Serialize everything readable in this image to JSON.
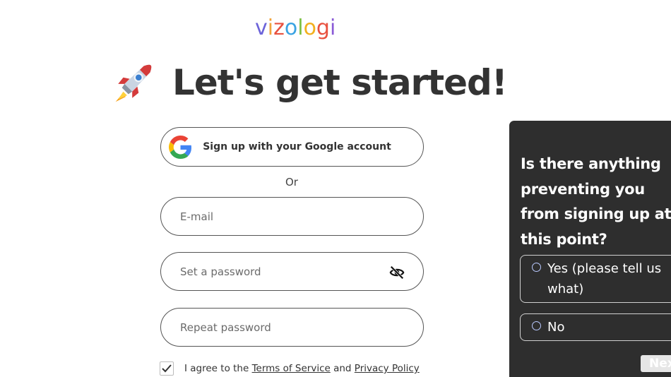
{
  "logo": {
    "letters": [
      "v",
      "i",
      "z",
      "o",
      "l",
      "o",
      "g",
      "i"
    ],
    "colors": [
      "#6c63d9",
      "#f2a33a",
      "#e8513f",
      "#3aa3e3",
      "#7bc043",
      "#f2b01e",
      "#e8513f",
      "#8a5bd6"
    ]
  },
  "heading": {
    "text": "Let's get started!",
    "icon": "rocket-icon"
  },
  "google_button": {
    "label": "Sign up with your Google account",
    "icon": "google-icon"
  },
  "divider_text": "Or",
  "fields": {
    "email": {
      "placeholder": "E-mail",
      "value": ""
    },
    "password": {
      "placeholder": "Set a password",
      "value": "",
      "icon": "eye-off-icon"
    },
    "repeat_password": {
      "placeholder": "Repeat password",
      "value": ""
    }
  },
  "agreement": {
    "checked": true,
    "prefix": "I agree to the ",
    "terms_link": "Terms of Service",
    "and": " and ",
    "privacy_link": "Privacy Policy"
  },
  "survey": {
    "question": "Is there anything preventing you from signing up at this point?",
    "options": [
      "Yes (please tell us what)",
      "No"
    ],
    "next_label": "Nex"
  }
}
